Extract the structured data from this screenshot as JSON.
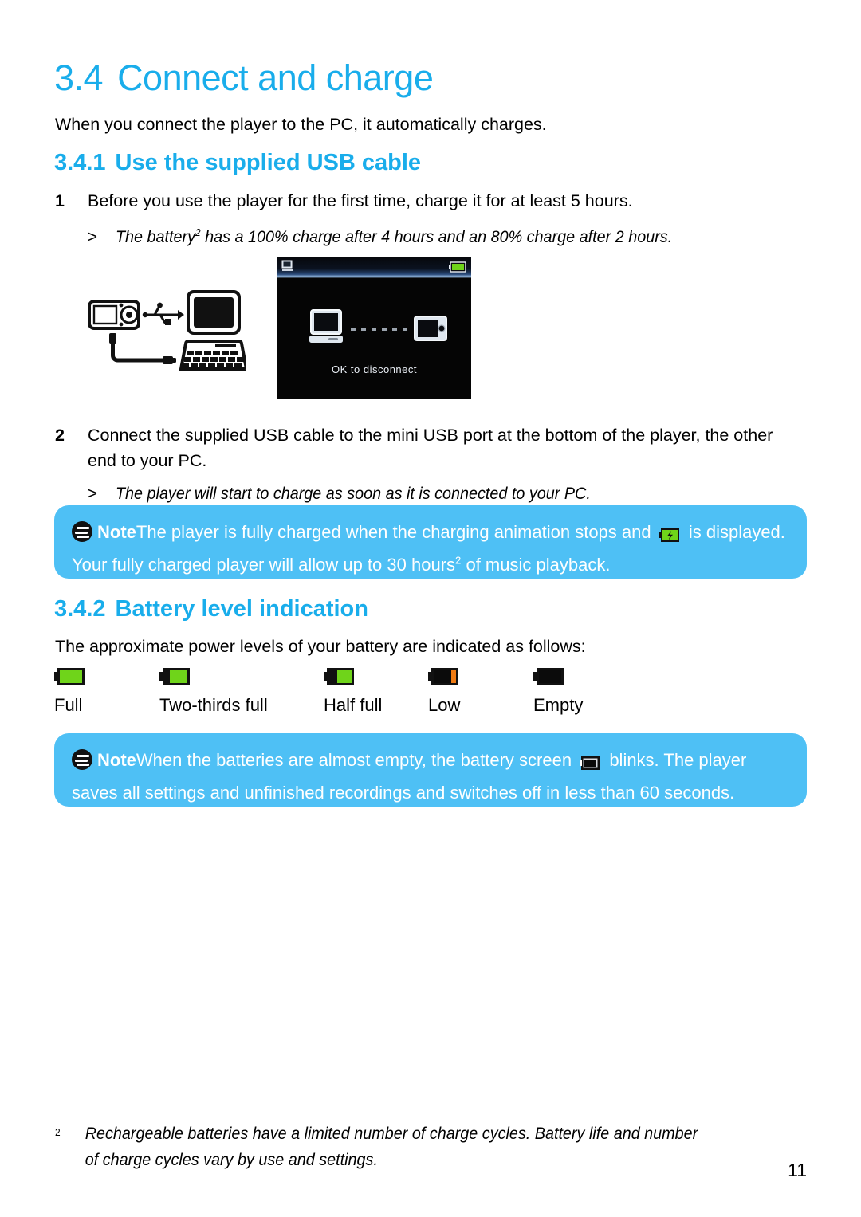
{
  "colors": {
    "heading_blue": "#19ADEB",
    "note_background": "#4EC0F5",
    "note_text": "#FFFFFF",
    "battery_green": "#6FD41A",
    "battery_low_orange": "#F07B13",
    "body_text": "#000000",
    "screen_black": "#050505"
  },
  "section": {
    "number": "3.4",
    "title": "Connect and charge",
    "intro": "When you connect the player to the PC, it automatically charges."
  },
  "subsection_1": {
    "number": "3.4.1",
    "title": "Use the supplied USB cable",
    "steps": [
      {
        "number": "1",
        "text": "Before you use the player for the first time, charge it for at least 5 hours."
      },
      {
        "number": "2",
        "text": "Connect the supplied USB cable to the mini USB port at the bottom of the player, the other end to your PC."
      }
    ],
    "results": [
      {
        "marker": ">",
        "text_before_sup": "The battery",
        "sup": "2",
        "text_after_sup": " has a 100% charge after 4 hours and an 80% charge after 2 hours."
      },
      {
        "marker": ">",
        "text": "The player will start to charge as soon as it is connected to your PC."
      }
    ]
  },
  "illustration": {
    "diagram_alt": "Player connected by USB cable to a desktop PC",
    "icons": [
      "mp3-player-icon",
      "usb-symbol-icon",
      "usb-cable-icon",
      "desktop-monitor-icon",
      "keyboard-icon"
    ],
    "device_screen": {
      "statusbar_left_icon": "pc-connected-icon",
      "statusbar_right_icon": "battery-full-icon",
      "center_left_icon": "computer-icon",
      "center_connector": "dotted-link",
      "center_right_icon": "player-icon",
      "caption": "OK to disconnect"
    }
  },
  "note_1": {
    "label": "Note",
    "text_part_1": "The player is fully charged when the charging animation stops and ",
    "icon": "battery-charging-icon",
    "text_part_2": " is displayed. Your fully charged player will allow up to 30 hours",
    "sup": "2",
    "text_part_3": " of music playback."
  },
  "subsection_2": {
    "number": "3.4.2",
    "title": "Battery level indication",
    "intro": "The approximate power levels of your battery are indicated as follows:",
    "levels": [
      {
        "label": "Full",
        "icon": "battery-full-icon",
        "fill_percent": 100,
        "fill_color": "#6FD41A"
      },
      {
        "label": "Two-thirds full",
        "icon": "battery-two-thirds-icon",
        "fill_percent": 67,
        "fill_color": "#6FD41A"
      },
      {
        "label": "Half full",
        "icon": "battery-half-icon",
        "fill_percent": 50,
        "fill_color": "#6FD41A"
      },
      {
        "label": "Low",
        "icon": "battery-low-icon",
        "fill_percent": 14,
        "fill_color": "#F07B13"
      },
      {
        "label": "Empty",
        "icon": "battery-empty-icon",
        "fill_percent": 0,
        "fill_color": "#000000"
      }
    ]
  },
  "note_2": {
    "label": "Note",
    "text_part_1": "When the batteries are almost empty, the battery screen ",
    "icon": "battery-empty-icon",
    "text_part_2": " blinks. The player saves all settings and unfinished recordings and switches off in less than 60 seconds."
  },
  "footnote": {
    "marker": "2",
    "text": "Rechargeable batteries have a limited number of charge cycles. Battery life and number of charge cycles vary by use and settings."
  },
  "page_number": "11"
}
